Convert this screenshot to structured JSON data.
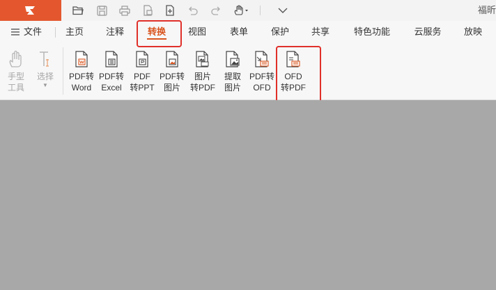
{
  "app": {
    "title": "福昕"
  },
  "quick_access": [
    {
      "name": "open-folder-icon"
    },
    {
      "name": "save-icon"
    },
    {
      "name": "print-icon"
    },
    {
      "name": "export-file-icon"
    },
    {
      "name": "new-file-icon"
    },
    {
      "name": "undo-icon"
    },
    {
      "name": "redo-icon"
    },
    {
      "name": "hand-tool-icon"
    },
    {
      "name": "customize-chevron-icon"
    }
  ],
  "menu": {
    "file_label": "文件",
    "tabs": [
      {
        "label": "主页"
      },
      {
        "label": "注释"
      },
      {
        "label": "转换",
        "active": true
      },
      {
        "label": "视图"
      },
      {
        "label": "表单"
      },
      {
        "label": "保护"
      },
      {
        "label": "共享"
      },
      {
        "label": "特色功能"
      },
      {
        "label": "云服务"
      },
      {
        "label": "放映"
      }
    ]
  },
  "ribbon": {
    "hand_tool": {
      "line1": "手型",
      "line2": "工具"
    },
    "select_tool": {
      "line1": "选择"
    },
    "convert_tools": [
      {
        "line1": "PDF转",
        "line2": "Word",
        "icon": "pdf-to-word-icon"
      },
      {
        "line1": "PDF转",
        "line2": "Excel",
        "icon": "pdf-to-excel-icon"
      },
      {
        "line1": "PDF",
        "line2": "转PPT",
        "icon": "pdf-to-ppt-icon"
      },
      {
        "line1": "PDF转",
        "line2": "图片",
        "icon": "pdf-to-image-icon"
      },
      {
        "line1": "图片",
        "line2": "转PDF",
        "icon": "image-to-pdf-icon"
      },
      {
        "line1": "提取",
        "line2": "图片",
        "icon": "extract-image-icon"
      },
      {
        "line1": "PDF转",
        "line2": "OFD",
        "icon": "pdf-to-ofd-icon"
      },
      {
        "line1": "OFD",
        "line2": "转PDF",
        "icon": "ofd-to-pdf-icon"
      }
    ]
  },
  "colors": {
    "brand": "#e4572e",
    "active_tab": "#d9541e",
    "highlight": "#e0302a",
    "doc_background": "#a8a8a8"
  }
}
